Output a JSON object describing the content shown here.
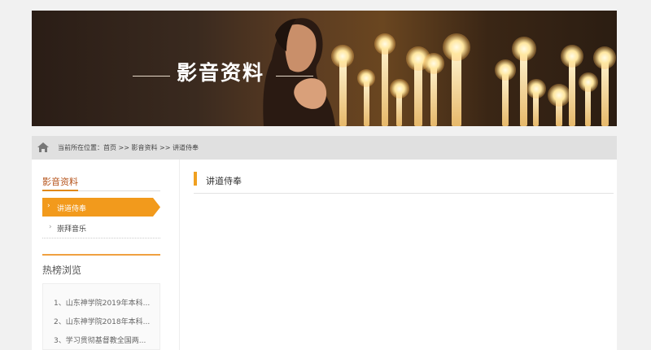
{
  "banner": {
    "title": "影音资料"
  },
  "breadcrumb": {
    "label": "当前所在位置：首页 >> 影音资料 >> 讲道侍奉"
  },
  "sidebar": {
    "title": "影音资料",
    "items": [
      {
        "label": "讲道侍奉",
        "active": true
      },
      {
        "label": "崇拜音乐",
        "active": false
      }
    ]
  },
  "hot": {
    "title": "热榜浏览",
    "items": [
      {
        "label": "1、山东神学院2019年本科..."
      },
      {
        "label": "2、山东神学院2018年本科..."
      },
      {
        "label": "3、学习贯彻基督教全国两..."
      }
    ]
  },
  "main": {
    "title": "讲道侍奉"
  },
  "colors": {
    "accent": "#f0a020",
    "active_bg": "#f29a1c",
    "title_red": "#b5531a"
  }
}
